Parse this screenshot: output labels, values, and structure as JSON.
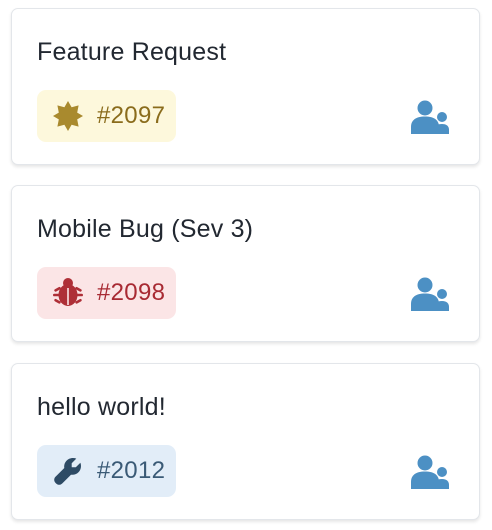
{
  "cards": [
    {
      "title": "Feature Request",
      "ticket": "#2097",
      "type_icon": "star-badge-icon",
      "colors": {
        "badge_bg": "#fdf8dc",
        "icon": "#a98a2e",
        "text": "#8a6c1c"
      }
    },
    {
      "title": "Mobile Bug (Sev 3)",
      "ticket": "#2098",
      "type_icon": "bug-icon",
      "colors": {
        "badge_bg": "#fbe5e6",
        "icon": "#ae2f37",
        "text": "#a82a33"
      }
    },
    {
      "title": "hello world!",
      "ticket": "#2012",
      "type_icon": "wrench-icon",
      "colors": {
        "badge_bg": "#e2edf8",
        "icon": "#2e4b65",
        "text": "#3a5a76"
      }
    }
  ],
  "assignee_icon": "users-icon",
  "assignee_color": "#4c90c4"
}
